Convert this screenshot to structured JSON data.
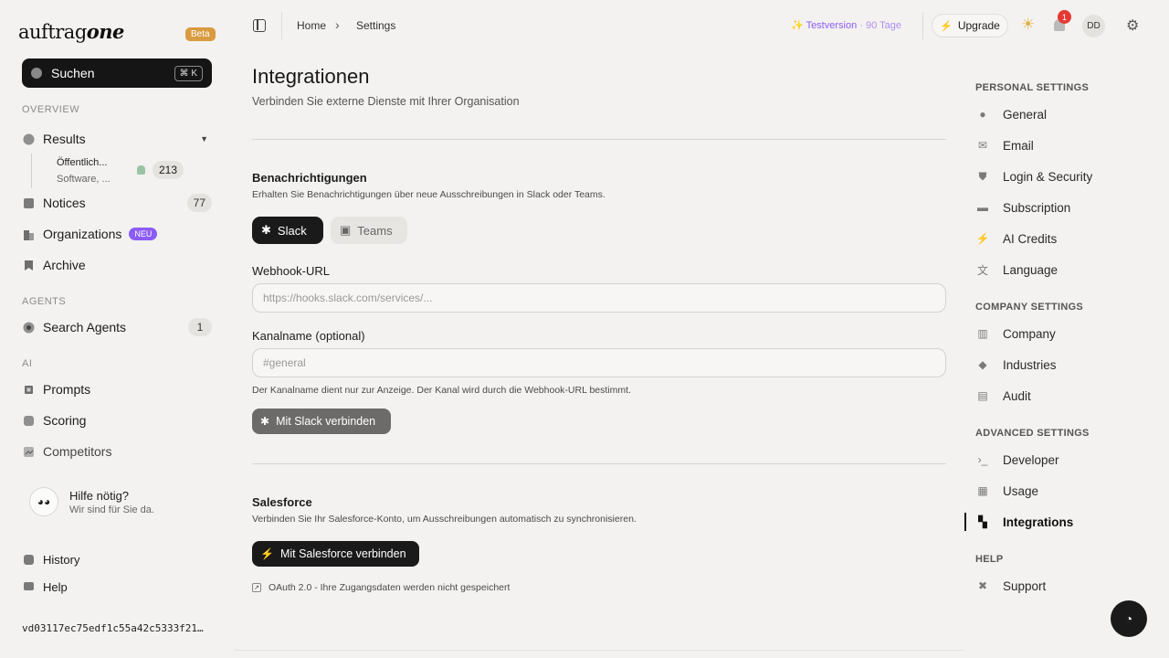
{
  "sidebar": {
    "logo_text": "auftrag",
    "logo_bold": "one",
    "beta": "Beta",
    "search_label": "Suchen",
    "search_shortcut": "⌘ K",
    "section_overview": "OVERVIEW",
    "section_agents": "AGENTS",
    "section_ai": "AI",
    "results": "Results",
    "sub_agent_title": "Öffentlich...",
    "sub_agent_desc": "Software, ...",
    "sub_agent_count": "213",
    "notices": "Notices",
    "notices_count": "77",
    "organizations": "Organizations",
    "organizations_badge": "NEU",
    "archive": "Archive",
    "search_agents": "Search Agents",
    "search_agents_count": "1",
    "prompts": "Prompts",
    "scoring": "Scoring",
    "competitors": "Competitors",
    "help_title": "Hilfe nötig?",
    "help_sub": "Wir sind für Sie da.",
    "history": "History",
    "help": "Help",
    "version_hash": "vd03117ec75edf1c55a42c5333f21…"
  },
  "topbar": {
    "breadcrumb_home": "Home",
    "breadcrumb_sep": "›",
    "breadcrumb_current": "Settings",
    "trial_label": "Testversion",
    "trial_days": "· 90 Tage",
    "upgrade": "Upgrade",
    "notification_count": "1",
    "avatar_initials": "DD"
  },
  "main": {
    "title": "Integrationen",
    "subtitle": "Verbinden Sie externe Dienste mit Ihrer Organisation",
    "notifications_title": "Benachrichtigungen",
    "notifications_desc": "Erhalten Sie Benachrichtigungen über neue Ausschreibungen in Slack oder Teams.",
    "tab_slack": "Slack",
    "tab_teams": "Teams",
    "webhook_label": "Webhook-URL",
    "webhook_placeholder": "https://hooks.slack.com/services/...",
    "channel_label": "Kanalname (optional)",
    "channel_placeholder": "#general",
    "channel_hint": "Der Kanalname dient nur zur Anzeige. Der Kanal wird durch die Webhook-URL bestimmt.",
    "connect_slack": "Mit Slack verbinden",
    "salesforce_title": "Salesforce",
    "salesforce_desc": "Verbinden Sie Ihr Salesforce-Konto, um Ausschreibungen automatisch zu synchronisieren.",
    "connect_salesforce": "Mit Salesforce verbinden",
    "oauth_note": "OAuth 2.0 - Ihre Zugangsdaten werden nicht gespeichert"
  },
  "settings_nav": {
    "personal": "PERSONAL SETTINGS",
    "general": "General",
    "email": "Email",
    "login_security": "Login & Security",
    "subscription": "Subscription",
    "ai_credits": "AI Credits",
    "language": "Language",
    "company_settings": "COMPANY SETTINGS",
    "company": "Company",
    "industries": "Industries",
    "audit": "Audit",
    "advanced": "ADVANCED SETTINGS",
    "developer": "Developer",
    "usage": "Usage",
    "integrations": "Integrations",
    "help_section": "HELP",
    "support": "Support"
  },
  "colors": {
    "accent_purple": "#8b5cf6",
    "beta_orange": "#d99a40",
    "dark": "#1a1a1a",
    "notification_red": "#e53935"
  }
}
